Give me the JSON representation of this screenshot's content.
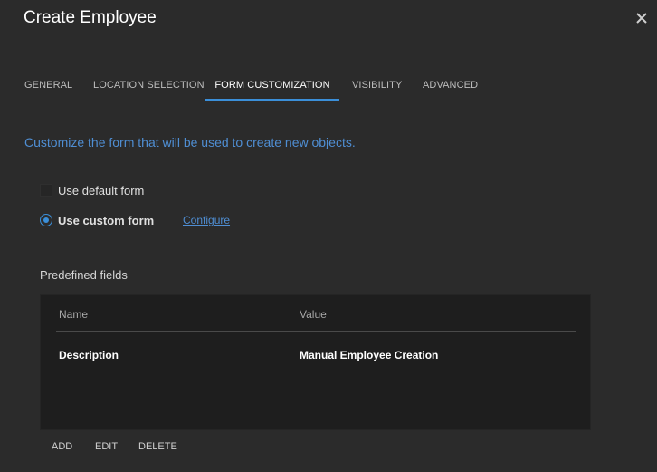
{
  "dialog": {
    "title": "Create Employee",
    "close_icon": "close-icon"
  },
  "tabs": [
    {
      "label": "GENERAL",
      "active": false
    },
    {
      "label": "LOCATION SELECTION",
      "active": false
    },
    {
      "label": "FORM CUSTOMIZATION",
      "active": true
    },
    {
      "label": "VISIBILITY",
      "active": false
    },
    {
      "label": "ADVANCED",
      "active": false
    }
  ],
  "form_customization": {
    "description": "Customize the form that will be used to create new objects.",
    "use_default_form": {
      "label": "Use default form",
      "checked": false
    },
    "use_custom_form": {
      "label": "Use custom form",
      "selected": true
    },
    "configure_link": "Configure"
  },
  "predefined_fields": {
    "label": "Predefined fields",
    "columns": [
      "Name",
      "Value"
    ],
    "rows": [
      {
        "name": "Description",
        "value": "Manual Employee Creation"
      }
    ],
    "actions": {
      "add": "ADD",
      "edit": "EDIT",
      "delete": "DELETE"
    }
  },
  "colors": {
    "background": "#2b2b2b",
    "accent": "#3b8fd9",
    "link": "#4f8ed3",
    "table_background": "#1e1e1e"
  }
}
